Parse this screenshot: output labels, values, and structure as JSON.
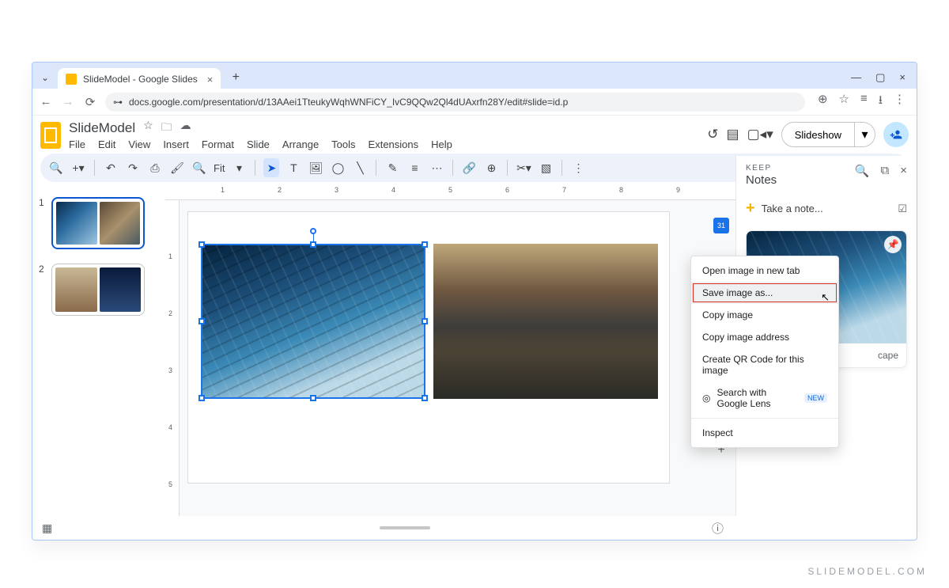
{
  "browser": {
    "tab_title": "SlideModel - Google Slides",
    "url": "docs.google.com/presentation/d/13AAei1TteukyWqhWNFiCY_IvC9QQw2Ql4dUAxrfn28Y/edit#slide=id.p"
  },
  "app": {
    "title": "SlideModel",
    "menus": [
      "File",
      "Edit",
      "View",
      "Insert",
      "Format",
      "Slide",
      "Arrange",
      "Tools",
      "Extensions",
      "Help"
    ],
    "slideshow_label": "Slideshow",
    "fit_label": "Fit"
  },
  "thumbnails": [
    {
      "num": "1",
      "selected": true
    },
    {
      "num": "2",
      "selected": false
    }
  ],
  "hruler": [
    "1",
    "2",
    "3",
    "4",
    "5",
    "6",
    "7",
    "8",
    "9"
  ],
  "vruler": [
    "1",
    "2",
    "3",
    "4",
    "5"
  ],
  "keep": {
    "label": "KEEP",
    "title": "Notes",
    "take": "Take a note...",
    "caption": "cape"
  },
  "context_menu": {
    "open_new_tab": "Open image in new tab",
    "save_as": "Save image as...",
    "copy": "Copy image",
    "copy_addr": "Copy image address",
    "qr": "Create QR Code for this image",
    "lens": "Search with Google Lens",
    "lens_badge": "NEW",
    "inspect": "Inspect"
  },
  "sidetabs": {
    "calendar": "31"
  },
  "watermark": "SLIDEMODEL.COM"
}
